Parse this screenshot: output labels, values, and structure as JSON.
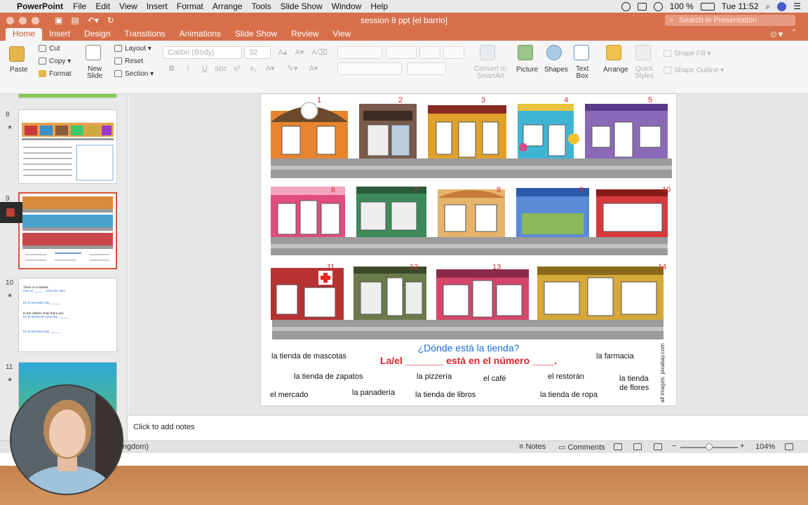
{
  "menubar": {
    "app_name": "PowerPoint",
    "items": [
      "File",
      "Edit",
      "View",
      "Insert",
      "Format",
      "Arrange",
      "Tools",
      "Slide Show",
      "Window",
      "Help"
    ],
    "battery": "100 %",
    "clock": "Tue 11:52"
  },
  "window": {
    "title": "session 8 ppt [el barrio]",
    "search_placeholder": "Search in Presentation"
  },
  "tabs": [
    "Home",
    "Insert",
    "Design",
    "Transitions",
    "Animations",
    "Slide Show",
    "Review",
    "View"
  ],
  "ribbon": {
    "paste": "Paste",
    "cut": "Cut",
    "copy": "Copy",
    "format": "Format",
    "new_slide_line1": "New",
    "new_slide_line2": "Slide",
    "layout": "Layout",
    "reset": "Reset",
    "section": "Section",
    "font_name": "Calibri (Body)",
    "font_size": "32",
    "convert_line1": "Convert to",
    "convert_line2": "SmartArt",
    "picture": "Picture",
    "shapes": "Shapes",
    "textbox_line1": "Text",
    "textbox_line2": "Box",
    "arrange": "Arrange",
    "quick_styles_line1": "Quick",
    "quick_styles_line2": "Styles",
    "shape_fill": "Shape Fill",
    "shape_outline": "Shape Outline"
  },
  "slides_panel": {
    "numbers": [
      "8",
      "9",
      "10",
      "11"
    ],
    "thumb10": {
      "line1": "There is a market:",
      "line2": "Hay un ______ cerca de casa.",
      "line3": "En el mercado hay ______",
      "line4": "In the clothes shop there are:",
      "line5": "En la tienda de ropa hay ______",
      "line6": "En la farmacia hay ______"
    }
  },
  "slide": {
    "shop_numbers": [
      "1",
      "2",
      "3",
      "4",
      "5",
      "6",
      "7",
      "8",
      "9",
      "10",
      "11",
      "12",
      "13",
      "14"
    ],
    "question": "¿Dónde está la tienda?",
    "answer_template": "La/el _______ está en el número ____.",
    "labels": {
      "mascotas": "la tienda de mascotas",
      "farmacia": "la farmacia",
      "zapatos": "la tienda de zapatos",
      "pizzeria": "la pizzería",
      "cafe": "el café",
      "restoran": "el restorán",
      "flores_line1": "la tienda",
      "flores_line2": "de flores",
      "mercado": "el mercado",
      "panaderia": "la panadería",
      "libros": "la tienda de libros",
      "ropa": "la tienda de ropa"
    },
    "credit": "all images: pixabay.com"
  },
  "notes_hint": "Click to add notes",
  "statusbar": {
    "language": "Kingdom)",
    "notes": "Notes",
    "comments": "Comments",
    "zoom": "104%"
  },
  "colors": {
    "accent": "#d76f4b",
    "question_blue": "#1a6fd0",
    "answer_red": "#d6262e"
  }
}
